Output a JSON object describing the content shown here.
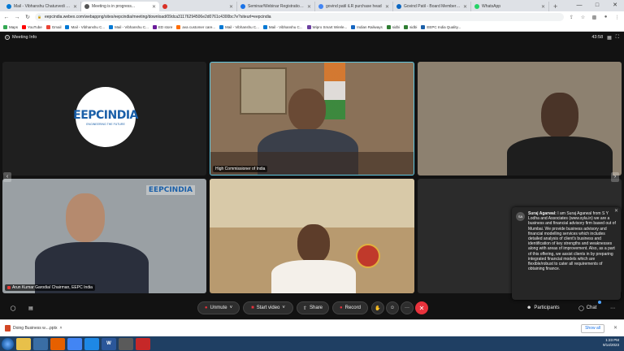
{
  "browser": {
    "tabs": [
      {
        "title": "Mail - Vibhanshu Chaturvedi - C",
        "color": "#0078d4",
        "active": false
      },
      {
        "title": "Meeting is in progress...",
        "color": "#555555",
        "active": true
      },
      {
        "title": "",
        "color": "#d93025",
        "active": false
      },
      {
        "title": "Seminar/Webinar Registration F",
        "color": "#1a73e8",
        "active": false
      },
      {
        "title": "govind patil iLR purchase head",
        "color": "#4285f4",
        "active": false
      },
      {
        "title": "Govind Patil - Board Member iLR",
        "color": "#0a66c2",
        "active": false
      },
      {
        "title": "WhatsApp",
        "color": "#25d366",
        "active": false
      }
    ],
    "new_tab": "+",
    "url": "eepcindia.webex.com/webappng/sites/eepcindia/meeting/download/09dca31176294506e2d0761c4300bc7e?siteurl=eepcindia",
    "bookmarks": [
      {
        "label": "Maps",
        "color": "#34a853"
      },
      {
        "label": "YouTube",
        "color": "#ff0000"
      },
      {
        "label": "Gmail",
        "color": "#ea4335"
      },
      {
        "label": "Mail - Vibhanshu C...",
        "color": "#0078d4"
      },
      {
        "label": "Mail - Vibhanshu C...",
        "color": "#0078d4"
      },
      {
        "label": "ED store",
        "color": "#6a1b9a"
      },
      {
        "label": "ava customer care...",
        "color": "#ff6d00"
      },
      {
        "label": "Mail - Vibhanshu C...",
        "color": "#0078d4"
      },
      {
        "label": "Mail - Vibhanshu C...",
        "color": "#0078d4"
      },
      {
        "label": "Wipro Smart Wirele...",
        "color": "#6b3fa0"
      },
      {
        "label": "Indian Railways",
        "color": "#1565c0"
      },
      {
        "label": "sidbi",
        "color": "#2e7d32"
      },
      {
        "label": "sidbi",
        "color": "#2e7d32"
      },
      {
        "label": "EEPC India Quality...",
        "color": "#1a5fa8"
      }
    ]
  },
  "meeting": {
    "header_title": "Meeting Info",
    "timer": "43:58",
    "tiles": [
      {
        "id": "t1",
        "label": "",
        "logo_text": "EEPCINDIA",
        "logo_sub": "ENGINEERING THE FUTURE"
      },
      {
        "id": "t2",
        "label": "High Commissioner of India"
      },
      {
        "id": "t3",
        "label": ""
      },
      {
        "id": "t4",
        "label": "Arun Kumar Garodia/ Chairman, EEPC India",
        "logo_text": "EEPCINDIA"
      },
      {
        "id": "t5",
        "label": ""
      },
      {
        "id": "t6",
        "label": ""
      }
    ],
    "chat_popup": {
      "sender": "Suraj Agarwal:",
      "initials": "SA",
      "message": "I am Suraj Agarwal from S Y Lodha and Associates (www.syla.in) we are a business and financial advisory firm based out of Mumbai. We provide business advisory and financial modelling services which includes detailed analysis of client's business and identification of key strengths and weaknesses along with areas of improvement. Also, as a part of this offering, we assist clients in by preparing integrated financial models which are flexible/robust to cater all requirements of obtaining finance."
    },
    "controls": {
      "unmute": "Unmute",
      "start_video": "Start video",
      "share": "Share",
      "record": "Record",
      "more": "···",
      "leave": "✕",
      "participants": "Participants",
      "chat": "Chat"
    }
  },
  "downloads": {
    "file": "Doing Business w....pptx",
    "show_all": "Show all",
    "close": "✕"
  },
  "taskbar": {
    "time": "1:23 PM",
    "date": "9/14/2023",
    "word_label": "W"
  }
}
